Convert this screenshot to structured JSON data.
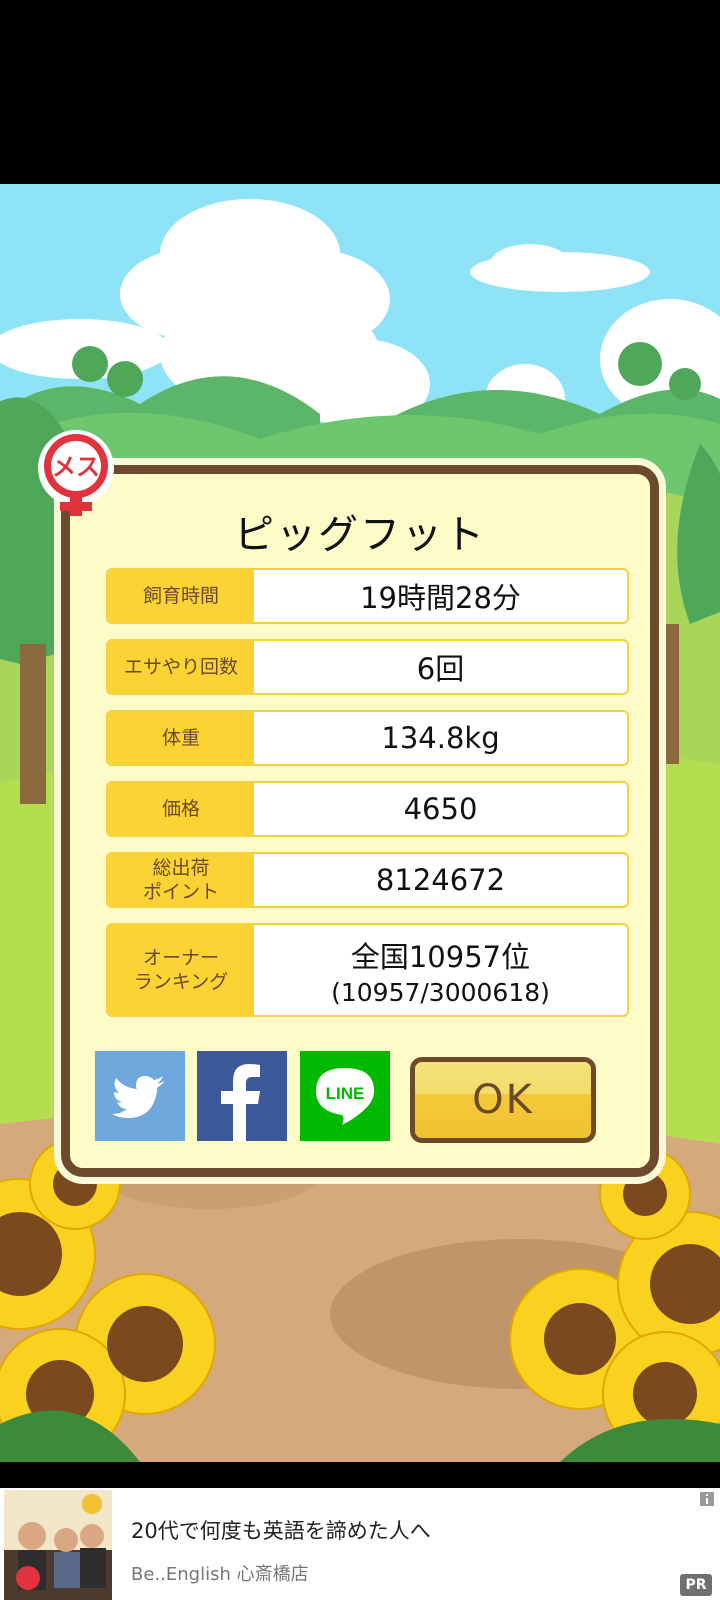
{
  "dialog": {
    "title": "ピッグフット",
    "stats": [
      {
        "label": "飼育時間",
        "value": "19時間28分"
      },
      {
        "label": "エサやり回数",
        "value": "6回"
      },
      {
        "label": "体重",
        "value": "134.8kg"
      },
      {
        "label": "価格",
        "value": "4650"
      },
      {
        "label": "総出荷\nポイント",
        "value": "8124672"
      },
      {
        "label": "オーナー\nランキング",
        "value": "全国10957位",
        "sub_value": "(10957/3000618)"
      }
    ],
    "share": {
      "twitter": {
        "icon": "twitter-bird-icon",
        "color": "#6fa8dc"
      },
      "facebook": {
        "icon": "facebook-f-icon",
        "color": "#3b5998"
      },
      "line": {
        "label": "LINE",
        "color": "#00b900"
      }
    },
    "ok_label": "OK"
  },
  "badge": {
    "label": "メス",
    "icon": "female-symbol-icon",
    "color": "#e0333e"
  },
  "ad": {
    "title": "20代で何度も英語を諦めた人へ",
    "sponsor": "Be..English 心斎橋店",
    "pr_label": "PR",
    "info_icon": "info-icon"
  },
  "colors": {
    "sky": "#8fe3f6",
    "dialog_border": "#6e4a2c",
    "dialog_bg": "#fdfbc8",
    "label_bg": "#fcd334"
  }
}
